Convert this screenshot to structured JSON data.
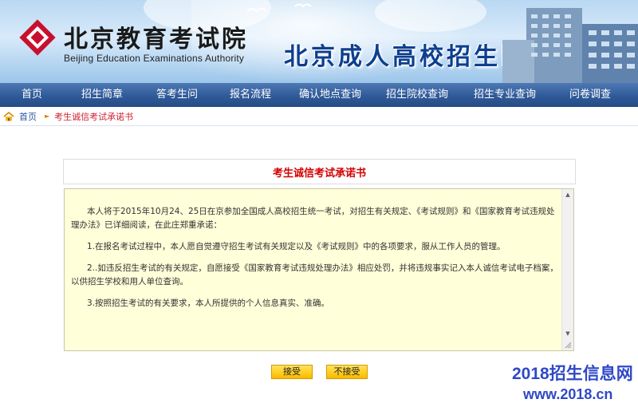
{
  "header": {
    "logo_cn": "北京教育考试院",
    "logo_en": "Beijing Education Examinations Authority",
    "site_title": "北京成人高校招生网上报名"
  },
  "nav": {
    "items": [
      {
        "label": "首页"
      },
      {
        "label": "招生简章"
      },
      {
        "label": "答考生问"
      },
      {
        "label": "报名流程"
      },
      {
        "label": "确认地点查询"
      },
      {
        "label": "招生院校查询"
      },
      {
        "label": "招生专业查询"
      },
      {
        "label": "问卷调查"
      }
    ]
  },
  "breadcrumb": {
    "home": "首页",
    "current": "考生诚信考试承诺书"
  },
  "pledge": {
    "title": "考生诚信考试承诺书",
    "intro": "本人将于2015年10月24、25日在京参加全国成人高校招生统一考试，对招生有关规定、《考试规则》和《国家教育考试违规处理办法》已详细阅读，在此庄郑重承诺：",
    "item1": "1.在报名考试过程中，本人愿自觉遵守招生考试有关规定以及《考试规则》中的各项要求，服从工作人员的管理。",
    "item2": "2..如违反招生考试的有关规定，自愿接受《国家教育考试违规处理办法》相应处罚，并将违规事实记入本人诚信考试电子档案，以供招生学校和用人单位查询。",
    "item3": "3.按照招生考试的有关要求，本人所提供的个人信息真实、准确。"
  },
  "actions": {
    "accept": "接受",
    "decline": "不接受"
  },
  "watermark": {
    "line1": "2018招生信息网",
    "line2": "www.2018.cn"
  },
  "colors": {
    "nav_bg": "#2f5a98",
    "title_red": "#d40000",
    "pledge_bg": "#ffffd9",
    "button_yellow": "#ffcc1f",
    "watermark_blue": "#2f49c6"
  }
}
